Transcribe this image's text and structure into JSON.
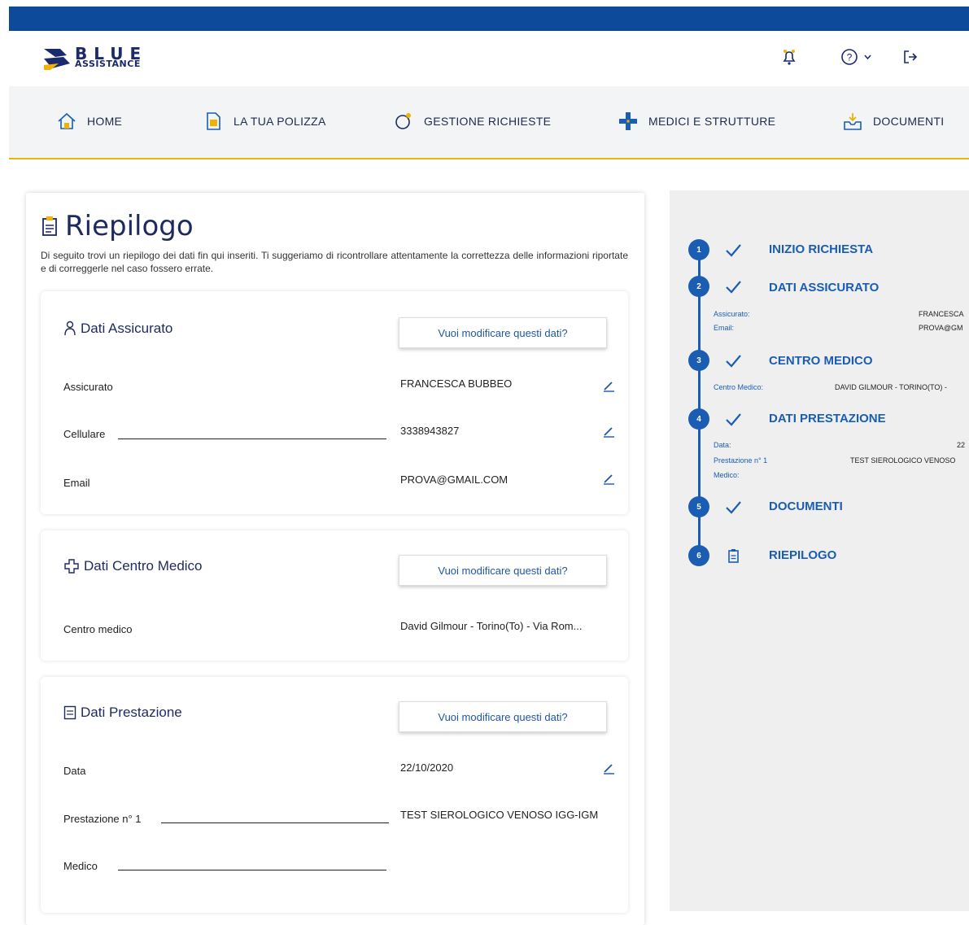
{
  "brand": {
    "line1": "BLUE",
    "line2": "ASSISTANCE"
  },
  "header_icons": [
    "bell-icon",
    "help-icon",
    "logout-icon"
  ],
  "nav": [
    {
      "label": "HOME",
      "icon": "home-icon"
    },
    {
      "label": "LA TUA POLIZZA",
      "icon": "document-icon"
    },
    {
      "label": "GESTIONE RICHIESTE",
      "icon": "requests-icon"
    },
    {
      "label": "MEDICI E STRUTTURE",
      "icon": "medical-cross-icon"
    },
    {
      "label": "DOCUMENTI",
      "icon": "inbox-icon"
    }
  ],
  "page": {
    "title": "Riepilogo",
    "intro": "Di seguito trovi un riepilogo dei dati fin qui inseriti. Ti suggeriamo di ricontrollare attentamente la correttezza delle informazioni riportate e di correggerle nel caso fossero errate."
  },
  "sections": {
    "assicurato": {
      "title": "Dati Assicurato",
      "button": "Vuoi modificare questi dati?",
      "rows": [
        {
          "label": "Assicurato",
          "value": "FRANCESCA BUBBEO"
        },
        {
          "label": "Cellulare",
          "value": "3338943827"
        },
        {
          "label": "Email",
          "value": "PROVA@GMAIL.COM"
        }
      ]
    },
    "centro": {
      "title": "Dati Centro Medico",
      "button": "Vuoi modificare questi dati?",
      "rows": [
        {
          "label": "Centro medico",
          "value": "David Gilmour - Torino(To) - Via Rom..."
        }
      ]
    },
    "prestazione": {
      "title": "Dati Prestazione",
      "button": "Vuoi modificare questi dati?",
      "rows": [
        {
          "label": "Data",
          "value": "22/10/2020"
        },
        {
          "label": "Prestazione n° 1",
          "value": "TEST SIEROLOGICO VENOSO IGG-IGM"
        },
        {
          "label": "Medico",
          "value": ""
        }
      ]
    }
  },
  "steps": [
    {
      "num": "1",
      "label": "INIZIO RICHIESTA"
    },
    {
      "num": "2",
      "label": "DATI ASSICURATO",
      "details": [
        {
          "k": "Assicurato:",
          "v": "FRANCESCA"
        },
        {
          "k": "Email:",
          "v": "PROVA@GM"
        }
      ]
    },
    {
      "num": "3",
      "label": "CENTRO MEDICO",
      "details": [
        {
          "k": "Centro Medico:",
          "v": "DAVID GILMOUR - TORINO(TO) -"
        }
      ]
    },
    {
      "num": "4",
      "label": "DATI PRESTAZIONE",
      "details": [
        {
          "k": "Data:",
          "v": "22"
        },
        {
          "k": "Prestazione n° 1",
          "v": "TEST SIEROLOGICO VENOSO"
        },
        {
          "k": "Medico:",
          "v": ""
        }
      ]
    },
    {
      "num": "5",
      "label": "DOCUMENTI"
    },
    {
      "num": "6",
      "label": "RIEPILOGO"
    }
  ],
  "colors": {
    "primary": "#0d4a9a",
    "accent": "#f0b400",
    "step": "#1a5db3",
    "dark": "#1e2a5e"
  }
}
